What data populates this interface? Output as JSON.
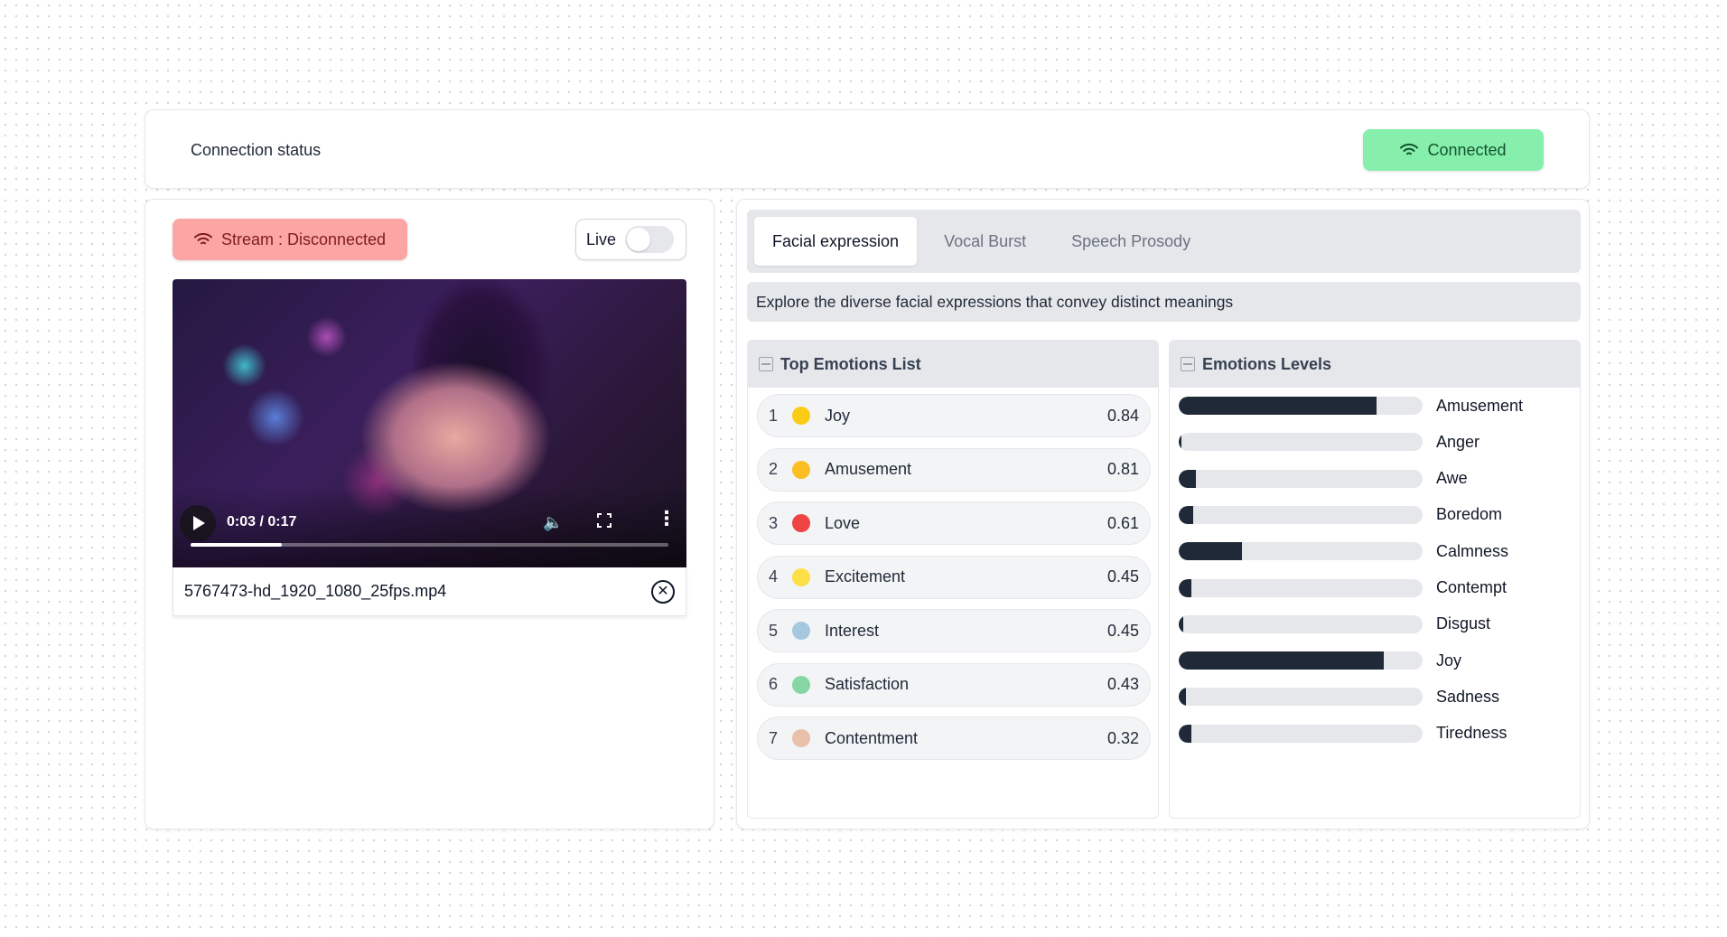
{
  "connection": {
    "label": "Connection status",
    "status": "Connected",
    "status_color": "#86efac"
  },
  "stream": {
    "status": "Stream : Disconnected",
    "status_color": "#fca5a5",
    "live_label": "Live",
    "live_on": false
  },
  "video": {
    "time": "0:03 / 0:17",
    "progress": 0.19,
    "filename": "5767473-hd_1920_1080_25fps.mp4"
  },
  "tabs": [
    {
      "label": "Facial expression",
      "active": true
    },
    {
      "label": "Vocal Burst",
      "active": false
    },
    {
      "label": "Speech Prosody",
      "active": false
    }
  ],
  "description": "Explore the diverse facial expressions that convey distinct meanings",
  "top_emotions": {
    "title": "Top Emotions List",
    "items": [
      {
        "rank": "1",
        "name": "Joy",
        "score": "0.84",
        "color": "#facc15"
      },
      {
        "rank": "2",
        "name": "Amusement",
        "score": "0.81",
        "color": "#fbbf24"
      },
      {
        "rank": "3",
        "name": "Love",
        "score": "0.61",
        "color": "#ef4444"
      },
      {
        "rank": "4",
        "name": "Excitement",
        "score": "0.45",
        "color": "#fde047"
      },
      {
        "rank": "5",
        "name": "Interest",
        "score": "0.45",
        "color": "#a5c8e0"
      },
      {
        "rank": "6",
        "name": "Satisfaction",
        "score": "0.43",
        "color": "#86d7a4"
      },
      {
        "rank": "7",
        "name": "Contentment",
        "score": "0.32",
        "color": "#e9c0a9"
      }
    ]
  },
  "levels": {
    "title": "Emotions Levels",
    "items": [
      {
        "name": "Amusement",
        "value": 0.81
      },
      {
        "name": "Anger",
        "value": 0.01
      },
      {
        "name": "Awe",
        "value": 0.07
      },
      {
        "name": "Boredom",
        "value": 0.06
      },
      {
        "name": "Calmness",
        "value": 0.26
      },
      {
        "name": "Contempt",
        "value": 0.05
      },
      {
        "name": "Disgust",
        "value": 0.02
      },
      {
        "name": "Joy",
        "value": 0.84
      },
      {
        "name": "Sadness",
        "value": 0.03
      },
      {
        "name": "Tiredness",
        "value": 0.05
      }
    ]
  }
}
